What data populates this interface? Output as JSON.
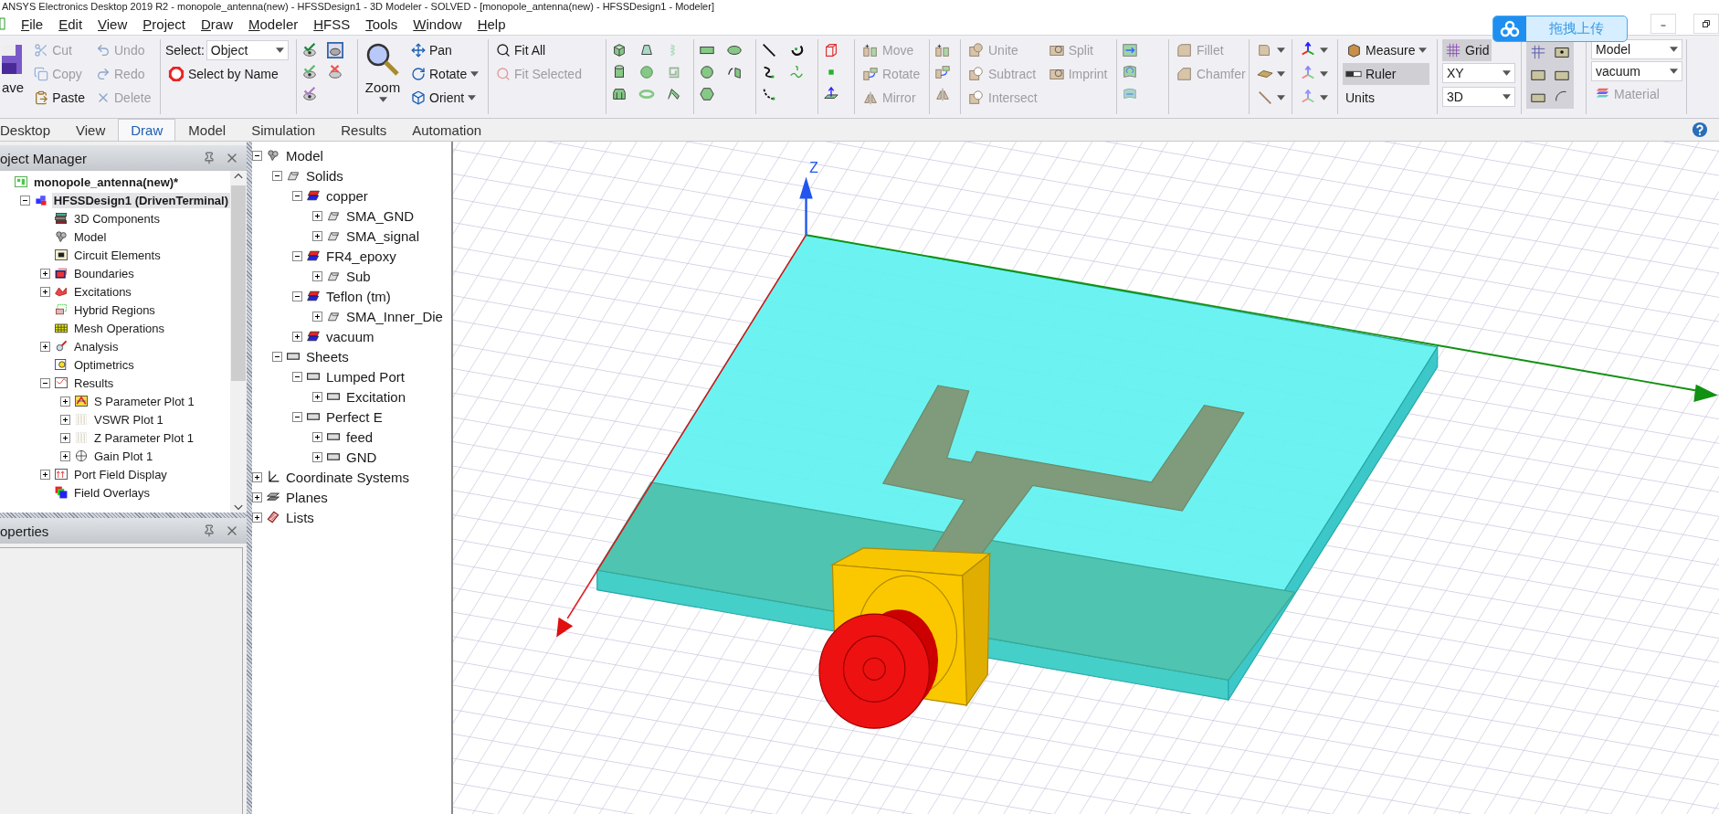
{
  "window": {
    "title": "ANSYS Electronics Desktop 2019 R2 - monopole_antenna(new) - HFSSDesign1 - 3D Modeler - SOLVED - [monopole_antenna(new) - HFSSDesign1 - Modeler]",
    "upload_button": "拖拽上传"
  },
  "menu": [
    "File",
    "Edit",
    "View",
    "Project",
    "Draw",
    "Modeler",
    "HFSS",
    "Tools",
    "Window",
    "Help"
  ],
  "ribbon": {
    "save": "ave",
    "clipboard": [
      {
        "label": "Cut",
        "disabled": true
      },
      {
        "label": "Copy",
        "disabled": true
      },
      {
        "label": "Paste",
        "disabled": false
      },
      {
        "label": "Undo",
        "disabled": true
      },
      {
        "label": "Redo",
        "disabled": true
      },
      {
        "label": "Delete",
        "disabled": true
      }
    ],
    "select": {
      "label": "Select:",
      "value": "Object",
      "by_name": "Select by Name"
    },
    "zoom": "Zoom",
    "view": [
      {
        "label": "Pan",
        "dropdown": false
      },
      {
        "label": "Rotate",
        "dropdown": true
      },
      {
        "label": "Orient",
        "dropdown": true
      }
    ],
    "fit": [
      {
        "label": "Fit All",
        "disabled": false
      },
      {
        "label": "Fit Selected",
        "disabled": true
      }
    ],
    "transform": [
      {
        "label": "Move",
        "disabled": true
      },
      {
        "label": "Rotate",
        "disabled": true
      },
      {
        "label": "Mirror",
        "disabled": true
      }
    ],
    "boolean": [
      {
        "label": "Unite",
        "disabled": true
      },
      {
        "label": "Subtract",
        "disabled": true
      },
      {
        "label": "Intersect",
        "disabled": true
      },
      {
        "label": "Split",
        "disabled": true
      },
      {
        "label": "Imprint",
        "disabled": true
      }
    ],
    "fillet": [
      {
        "label": "Fillet",
        "disabled": true
      },
      {
        "label": "Chamfer",
        "disabled": true
      }
    ],
    "measure": [
      {
        "label": "Measure",
        "dropdown": true,
        "selected": false
      },
      {
        "label": "Ruler",
        "dropdown": false,
        "selected": true
      },
      {
        "label": "Units",
        "dropdown": false,
        "selected": false
      }
    ],
    "grid": {
      "label": "Grid",
      "selected": true,
      "plane": "XY",
      "mode": "3D"
    },
    "material": {
      "object": "Model",
      "value": "vacuum",
      "button": "Material",
      "disabled": true
    }
  },
  "tabs": [
    {
      "label": "Desktop",
      "selected": false
    },
    {
      "label": "View",
      "selected": false
    },
    {
      "label": "Draw",
      "selected": true
    },
    {
      "label": "Model",
      "selected": false
    },
    {
      "label": "Simulation",
      "selected": false
    },
    {
      "label": "Results",
      "selected": false
    },
    {
      "label": "Automation",
      "selected": false
    }
  ],
  "project_manager": {
    "title": "oject Manager",
    "tree": [
      {
        "label": "monopole_antenna(new)*",
        "kind": "project",
        "selected": false,
        "children": [
          {
            "label": "HFSSDesign1 (DrivenTerminal)",
            "kind": "design",
            "expanded": true,
            "selected": true,
            "children": [
              {
                "label": "3D Components",
                "kind": "components",
                "selected": false
              },
              {
                "label": "Model",
                "kind": "model",
                "selected": false
              },
              {
                "label": "Circuit Elements",
                "kind": "circuit",
                "selected": false
              },
              {
                "label": "Boundaries",
                "kind": "boundaries",
                "expanded": false,
                "selected": false
              },
              {
                "label": "Excitations",
                "kind": "excitations",
                "expanded": false,
                "selected": false
              },
              {
                "label": "Hybrid Regions",
                "kind": "hybrid",
                "selected": false
              },
              {
                "label": "Mesh Operations",
                "kind": "mesh",
                "selected": false
              },
              {
                "label": "Analysis",
                "kind": "analysis",
                "expanded": false,
                "selected": false
              },
              {
                "label": "Optimetrics",
                "kind": "optimetrics",
                "selected": false
              },
              {
                "label": "Results",
                "kind": "results",
                "expanded": true,
                "selected": false,
                "children": [
                  {
                    "label": "S Parameter Plot 1",
                    "kind": "splot",
                    "expanded": false,
                    "selected": false
                  },
                  {
                    "label": "VSWR Plot 1",
                    "kind": "rplot",
                    "expanded": false,
                    "selected": false
                  },
                  {
                    "label": "Z Parameter Plot 1",
                    "kind": "rplot",
                    "expanded": false,
                    "selected": false
                  },
                  {
                    "label": "Gain Plot 1",
                    "kind": "gain",
                    "expanded": false,
                    "selected": false
                  }
                ]
              },
              {
                "label": "Port Field Display",
                "kind": "portfield",
                "expanded": false,
                "selected": false
              },
              {
                "label": "Field Overlays",
                "kind": "overlays",
                "selected": false
              }
            ]
          }
        ]
      }
    ]
  },
  "properties": {
    "title": "operties"
  },
  "model_tree": [
    {
      "label": "Model",
      "kind": "model",
      "expanded": true,
      "children": [
        {
          "label": "Solids",
          "kind": "solid",
          "expanded": true,
          "children": [
            {
              "label": "copper",
              "kind": "material",
              "expanded": true,
              "children": [
                {
                  "label": "SMA_GND",
                  "kind": "solid",
                  "expanded": false
                },
                {
                  "label": "SMA_signal",
                  "kind": "solid",
                  "expanded": false
                }
              ]
            },
            {
              "label": "FR4_epoxy",
              "kind": "material",
              "expanded": true,
              "children": [
                {
                  "label": "Sub",
                  "kind": "solid",
                  "expanded": false
                }
              ]
            },
            {
              "label": "Teflon (tm)",
              "kind": "material",
              "expanded": true,
              "children": [
                {
                  "label": "SMA_Inner_Die",
                  "kind": "solid",
                  "expanded": false
                }
              ]
            },
            {
              "label": "vacuum",
              "kind": "material",
              "expanded": false
            }
          ]
        },
        {
          "label": "Sheets",
          "kind": "sheet",
          "expanded": true,
          "children": [
            {
              "label": "Lumped Port",
              "kind": "sheet",
              "expanded": true,
              "children": [
                {
                  "label": "Excitation",
                  "kind": "sheet",
                  "expanded": false
                }
              ]
            },
            {
              "label": "Perfect E",
              "kind": "sheet",
              "expanded": true,
              "children": [
                {
                  "label": "feed",
                  "kind": "sheet",
                  "expanded": false
                },
                {
                  "label": "GND",
                  "kind": "sheet",
                  "expanded": false
                }
              ]
            }
          ]
        }
      ]
    },
    {
      "label": "Coordinate Systems",
      "kind": "coords",
      "expanded": false
    },
    {
      "label": "Planes",
      "kind": "planes",
      "expanded": false
    },
    {
      "label": "Lists",
      "kind": "lists",
      "expanded": false
    }
  ],
  "viewport": {
    "axis_label": "Z"
  }
}
